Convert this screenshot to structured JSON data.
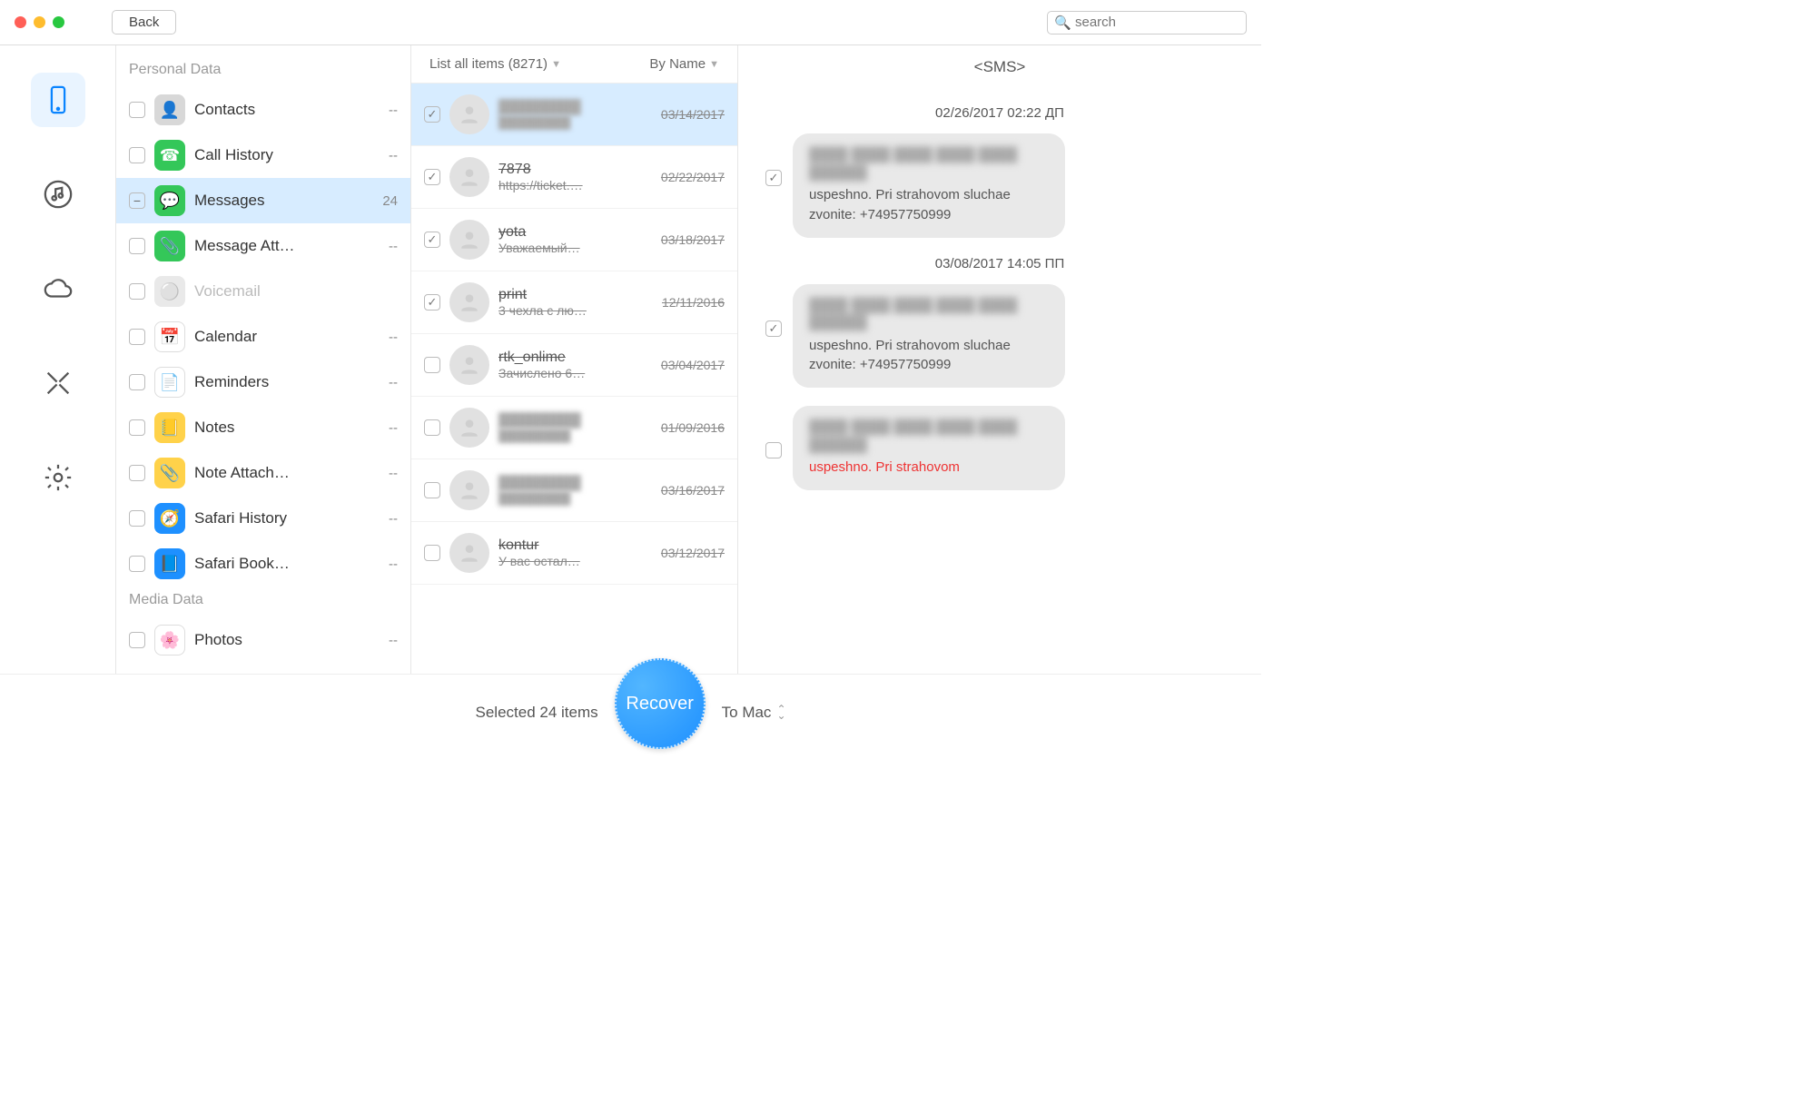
{
  "header": {
    "back_label": "Back",
    "search_placeholder": "search"
  },
  "rail": {
    "items": [
      {
        "name": "device",
        "active": true
      },
      {
        "name": "itunes",
        "active": false
      },
      {
        "name": "icloud",
        "active": false
      },
      {
        "name": "tools",
        "active": false
      },
      {
        "name": "settings",
        "active": false
      }
    ]
  },
  "categories": {
    "sections": [
      {
        "title": "Personal Data",
        "items": [
          {
            "id": "contacts",
            "label": "Contacts",
            "count": "--",
            "icon_bg": "#d8d8d8",
            "glyph": "👤",
            "check": "empty"
          },
          {
            "id": "call-history",
            "label": "Call History",
            "count": "--",
            "icon_bg": "#34c759",
            "glyph": "☎",
            "check": "empty"
          },
          {
            "id": "messages",
            "label": "Messages",
            "count": "24",
            "icon_bg": "#34c759",
            "glyph": "💬",
            "check": "minus",
            "active": true
          },
          {
            "id": "message-att",
            "label": "Message Att…",
            "count": "--",
            "icon_bg": "#34c759",
            "glyph": "📎",
            "check": "empty"
          },
          {
            "id": "voicemail",
            "label": "Voicemail",
            "count": "",
            "icon_bg": "#e9e9e9",
            "glyph": "⚪",
            "check": "empty",
            "disabled": true
          },
          {
            "id": "calendar",
            "label": "Calendar",
            "count": "--",
            "icon_bg": "#ffffff",
            "glyph": "📅",
            "check": "empty",
            "border": true
          },
          {
            "id": "reminders",
            "label": "Reminders",
            "count": "--",
            "icon_bg": "#ffffff",
            "glyph": "📄",
            "check": "empty",
            "border": true
          },
          {
            "id": "notes",
            "label": "Notes",
            "count": "--",
            "icon_bg": "#ffd24a",
            "glyph": "📒",
            "check": "empty"
          },
          {
            "id": "note-att",
            "label": "Note Attach…",
            "count": "--",
            "icon_bg": "#ffd24a",
            "glyph": "📎",
            "check": "empty"
          },
          {
            "id": "safari-history",
            "label": "Safari History",
            "count": "--",
            "icon_bg": "#1e90ff",
            "glyph": "🧭",
            "check": "empty"
          },
          {
            "id": "safari-book",
            "label": "Safari Book…",
            "count": "--",
            "icon_bg": "#1e90ff",
            "glyph": "📘",
            "check": "empty"
          }
        ]
      },
      {
        "title": "Media Data",
        "items": [
          {
            "id": "photos",
            "label": "Photos",
            "count": "--",
            "icon_bg": "#ffffff",
            "glyph": "🌸",
            "check": "empty",
            "border": true
          }
        ]
      }
    ]
  },
  "threads_header": {
    "filter_label": "List all items (8271)",
    "sort_label": "By Name"
  },
  "threads": [
    {
      "name": "████████",
      "preview": "████████",
      "date": "03/14/2017",
      "checked": true,
      "selected": true,
      "blurred": true
    },
    {
      "name": "7878",
      "preview": "https://ticket.…",
      "date": "02/22/2017",
      "checked": true
    },
    {
      "name": "yota",
      "preview": "Уважаемый…",
      "date": "03/18/2017",
      "checked": true
    },
    {
      "name": "print",
      "preview": "3 чехла с лю…",
      "date": "12/11/2016",
      "checked": true
    },
    {
      "name": "rtk_onlime",
      "preview": "Зачислено 6…",
      "date": "03/04/2017",
      "checked": false
    },
    {
      "name": "████████",
      "preview": "████████",
      "date": "01/09/2016",
      "checked": false,
      "blurred": true
    },
    {
      "name": "████████",
      "preview": "████████",
      "date": "03/16/2017",
      "checked": false,
      "blurred": true
    },
    {
      "name": "kontur",
      "preview": "У вас остал…",
      "date": "03/12/2017",
      "checked": false
    }
  ],
  "conversation": {
    "title": "<SMS>",
    "entries": [
      {
        "type": "time",
        "text": "02/26/2017 02:22 ДП"
      },
      {
        "type": "bubble",
        "checked": true,
        "blurred_lines": "████ ████ ████ ████\n████ ██████",
        "visible_text": "uspeshno. Pri strahovom sluchae zvonite: +74957750999"
      },
      {
        "type": "time",
        "text": "03/08/2017 14:05 ПП"
      },
      {
        "type": "bubble",
        "checked": true,
        "blurred_lines": "████ ████ ████ ████\n████ ██████",
        "visible_text": "uspeshno. Pri strahovom sluchae zvonite: +74957750999"
      },
      {
        "type": "bubble",
        "checked": false,
        "red": true,
        "blurred_lines": "████ ████ ████ ████\n████ ██████",
        "visible_text": "uspeshno. Pri strahovom"
      }
    ]
  },
  "footer": {
    "selected_label": "Selected 24 items",
    "recover_label": "Recover",
    "target_label": "To Mac"
  }
}
